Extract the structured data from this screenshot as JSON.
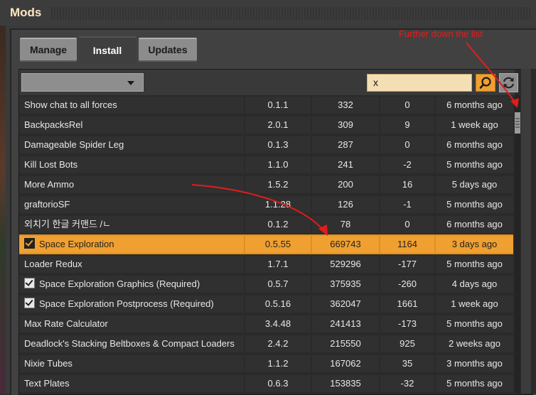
{
  "window": {
    "title": "Mods"
  },
  "tabs": [
    {
      "label": "Manage",
      "active": false
    },
    {
      "label": "Install",
      "active": true
    },
    {
      "label": "Updates",
      "active": false
    }
  ],
  "toolbar": {
    "dropdown_value": "",
    "search_value": "x"
  },
  "annotation": {
    "text": "Further down the list"
  },
  "colors": {
    "accent": "#f0a030",
    "annotation": "#e21c1c"
  },
  "mods": [
    {
      "name": "Show chat to all forces",
      "version": "0.1.1",
      "downloads": "332",
      "score": "0",
      "updated": "6 months ago",
      "installed": false,
      "highlight": false
    },
    {
      "name": "BackpacksRel",
      "version": "2.0.1",
      "downloads": "309",
      "score": "9",
      "updated": "1 week ago",
      "installed": false,
      "highlight": false
    },
    {
      "name": "Damageable Spider Leg",
      "version": "0.1.3",
      "downloads": "287",
      "score": "0",
      "updated": "6 months ago",
      "installed": false,
      "highlight": false
    },
    {
      "name": "Kill Lost Bots",
      "version": "1.1.0",
      "downloads": "241",
      "score": "-2",
      "updated": "5 months ago",
      "installed": false,
      "highlight": false
    },
    {
      "name": "More Ammo",
      "version": "1.5.2",
      "downloads": "200",
      "score": "16",
      "updated": "5 days ago",
      "installed": false,
      "highlight": false
    },
    {
      "name": "graftorioSF",
      "version": "1.1.28",
      "downloads": "126",
      "score": "-1",
      "updated": "5 months ago",
      "installed": false,
      "highlight": false
    },
    {
      "name": "외치기 한글 커맨드 /ㄴ",
      "version": "0.1.2",
      "downloads": "78",
      "score": "0",
      "updated": "6 months ago",
      "installed": false,
      "highlight": false
    },
    {
      "name": "Space Exploration",
      "version": "0.5.55",
      "downloads": "669743",
      "score": "1164",
      "updated": "3 days ago",
      "installed": true,
      "highlight": true
    },
    {
      "name": "Loader Redux",
      "version": "1.7.1",
      "downloads": "529296",
      "score": "-177",
      "updated": "5 months ago",
      "installed": false,
      "highlight": false
    },
    {
      "name": "Space Exploration Graphics (Required)",
      "version": "0.5.7",
      "downloads": "375935",
      "score": "-260",
      "updated": "4 days ago",
      "installed": true,
      "highlight": false
    },
    {
      "name": "Space Exploration Postprocess (Required)",
      "version": "0.5.16",
      "downloads": "362047",
      "score": "1661",
      "updated": "1 week ago",
      "installed": true,
      "highlight": false
    },
    {
      "name": "Max Rate Calculator",
      "version": "3.4.48",
      "downloads": "241413",
      "score": "-173",
      "updated": "5 months ago",
      "installed": false,
      "highlight": false
    },
    {
      "name": "Deadlock's Stacking Beltboxes & Compact Loaders",
      "version": "2.4.2",
      "downloads": "215550",
      "score": "925",
      "updated": "2 weeks ago",
      "installed": false,
      "highlight": false
    },
    {
      "name": "Nixie Tubes",
      "version": "1.1.2",
      "downloads": "167062",
      "score": "35",
      "updated": "3 months ago",
      "installed": false,
      "highlight": false
    },
    {
      "name": "Text Plates",
      "version": "0.6.3",
      "downloads": "153835",
      "score": "-32",
      "updated": "5 months ago",
      "installed": false,
      "highlight": false
    }
  ]
}
